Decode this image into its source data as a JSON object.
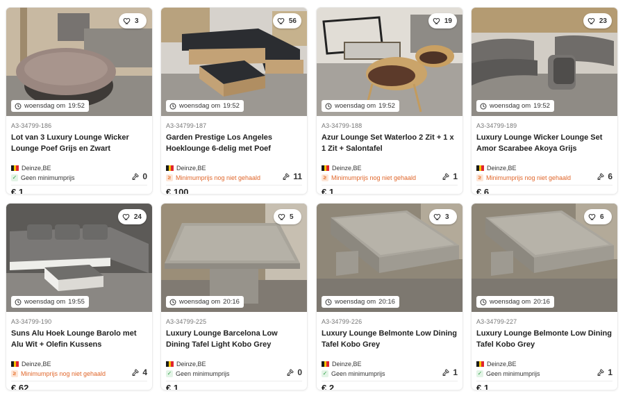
{
  "closing_prefix": "woensdag om",
  "lots": [
    {
      "favorites": "3",
      "closing_time": "19:52",
      "lot_number": "A3-34799-186",
      "title": "Lot van 3 Luxury Lounge Wicker Lounge Poef Grijs en Zwart",
      "location": "Deinze,BE",
      "min_status": "ok",
      "min_text": "Geen minimumprijs",
      "bids": "0",
      "price": "€ 1",
      "image_icon": "wicker-pouf-photo"
    },
    {
      "favorites": "56",
      "closing_time": "19:52",
      "lot_number": "A3-34799-187",
      "title": "Garden Prestige Los Angeles Hoeklounge 6-delig met Poef",
      "location": "Deinze,BE",
      "min_status": "no",
      "min_text": "Minimumprijs nog niet gehaald",
      "bids": "11",
      "price": "€ 100",
      "image_icon": "corner-sofa-photo"
    },
    {
      "favorites": "19",
      "closing_time": "19:52",
      "lot_number": "A3-34799-188",
      "title": "Azur Lounge Set Waterloo 2 Zit + 1 x 1 Zit + Salontafel",
      "location": "Deinze,BE",
      "min_status": "no",
      "min_text": "Minimumprijs nog niet gehaald",
      "bids": "1",
      "price": "€ 1",
      "image_icon": "rope-chairs-photo"
    },
    {
      "favorites": "23",
      "closing_time": "19:52",
      "lot_number": "A3-34799-189",
      "title": "Luxury Lounge Wicker Lounge Set Amor Scarabee Akoya Grijs",
      "location": "Deinze,BE",
      "min_status": "no",
      "min_text": "Minimumprijs nog niet gehaald",
      "bids": "6",
      "price": "€ 6",
      "image_icon": "curved-sofa-photo"
    },
    {
      "favorites": "24",
      "closing_time": "19:55",
      "lot_number": "A3-34799-190",
      "title": "Suns Alu Hoek Lounge Barolo met Alu Wit + Olefin Kussens",
      "location": "Deinze,BE",
      "min_status": "no",
      "min_text": "Minimumprijs nog niet gehaald",
      "bids": "4",
      "price": "€ 62",
      "image_icon": "alu-corner-lounge-photo"
    },
    {
      "favorites": "5",
      "closing_time": "20:16",
      "lot_number": "A3-34799-225",
      "title": "Luxury Lounge Barcelona Low Dining Tafel Light Kobo Grey",
      "location": "Deinze,BE",
      "min_status": "ok",
      "min_text": "Geen minimumprijs",
      "bids": "0",
      "price": "€ 1",
      "image_icon": "wicker-table-photo"
    },
    {
      "favorites": "3",
      "closing_time": "20:16",
      "lot_number": "A3-34799-226",
      "title": "Luxury Lounge Belmonte Low Dining Tafel Kobo Grey",
      "location": "Deinze,BE",
      "min_status": "ok",
      "min_text": "Geen minimumprijs",
      "bids": "1",
      "price": "€ 2",
      "image_icon": "long-wicker-table-photo"
    },
    {
      "favorites": "6",
      "closing_time": "20:16",
      "lot_number": "A3-34799-227",
      "title": "Luxury Lounge Belmonte Low Dining Tafel Kobo Grey",
      "location": "Deinze,BE",
      "min_status": "ok",
      "min_text": "Geen minimumprijs",
      "bids": "1",
      "price": "€ 1",
      "image_icon": "long-wicker-table-photo"
    }
  ],
  "colors": {
    "flag_black": "#1a1a1a",
    "flag_yellow": "#f5c400",
    "flag_red": "#e0252f",
    "min_ok": "#2f9e46",
    "min_not_reached": "#e0662a"
  }
}
